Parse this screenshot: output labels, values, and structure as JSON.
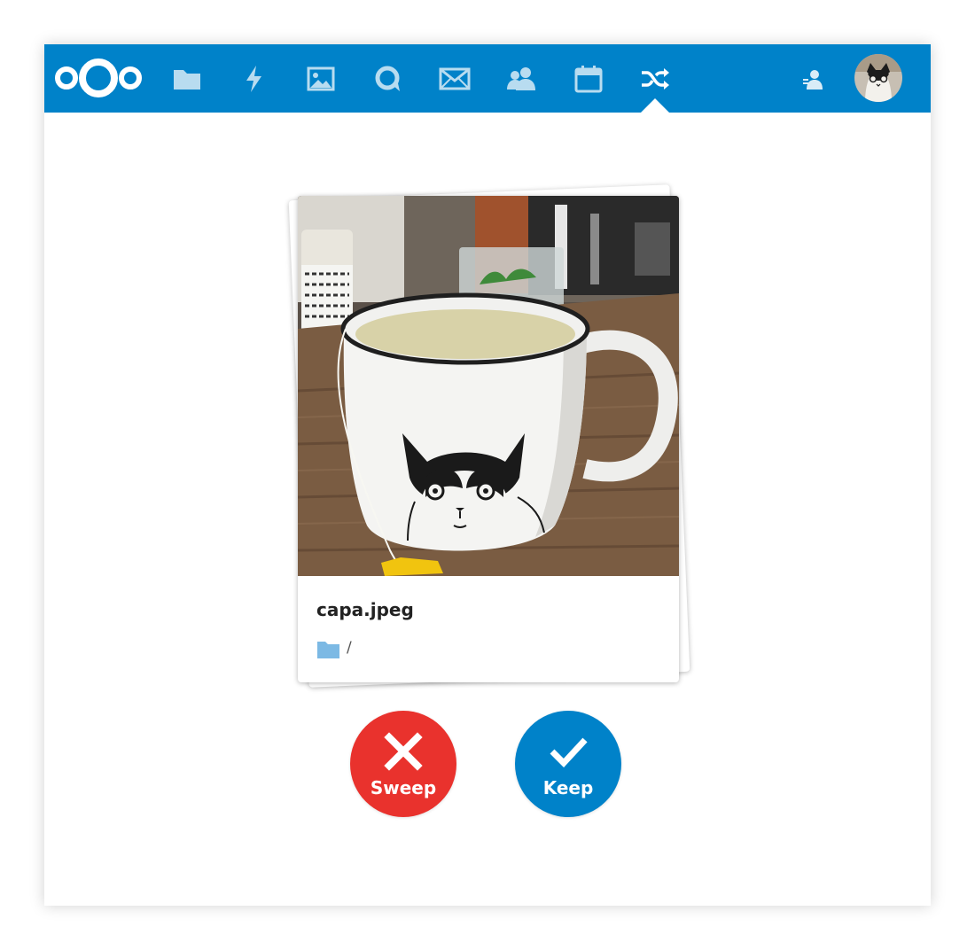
{
  "header": {
    "logo_icon": "nextcloud-logo-icon",
    "nav": [
      {
        "icon": "files-icon",
        "active": false
      },
      {
        "icon": "activity-icon",
        "active": false
      },
      {
        "icon": "gallery-icon",
        "active": false
      },
      {
        "icon": "talk-icon",
        "active": false
      },
      {
        "icon": "mail-icon",
        "active": false
      },
      {
        "icon": "contacts-icon",
        "active": false
      },
      {
        "icon": "calendar-icon",
        "active": false
      },
      {
        "icon": "shuffle-icon",
        "active": true
      }
    ],
    "contacts_menu_icon": "contacts-menu-icon",
    "avatar_icon": "user-avatar-icon"
  },
  "card": {
    "file_name": "capa.jpeg",
    "path": "/",
    "folder_icon": "folder-icon"
  },
  "actions": {
    "sweep_label": "Sweep",
    "keep_label": "Keep"
  },
  "colors": {
    "header": "#0082c9",
    "sweep": "#e9322d",
    "keep": "#0082c9"
  }
}
